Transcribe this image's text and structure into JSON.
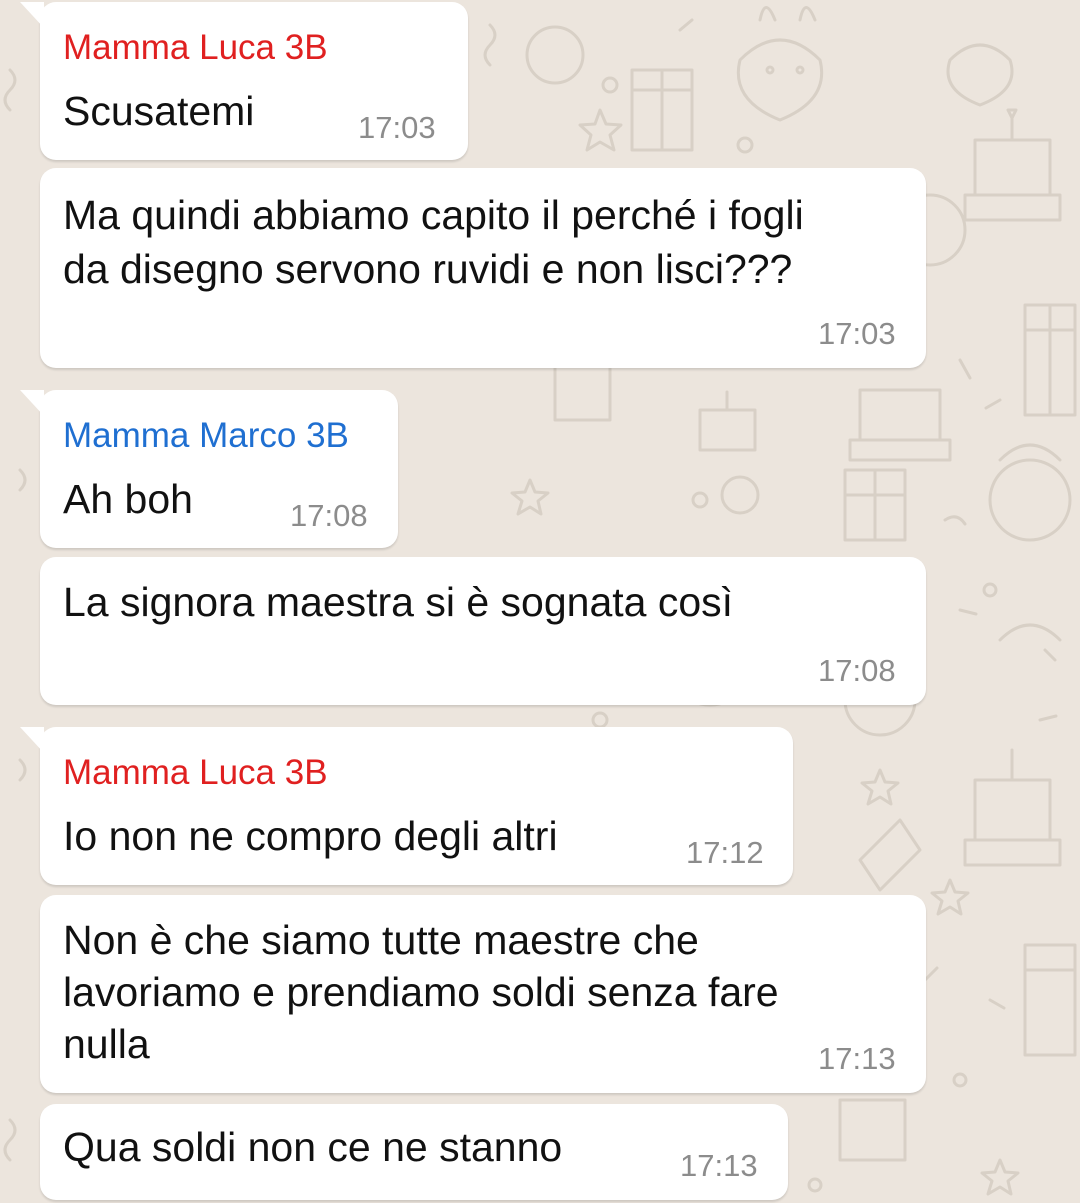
{
  "chat": {
    "messages": [
      {
        "sender": "Mamma Luca 3B",
        "sender_color": "#e02020",
        "text": "Scusatemi",
        "time": "17:03"
      },
      {
        "sender": "",
        "text_lines": [
          "Ma quindi abbiamo capito il perché i fogli",
          "da disegno servono ruvidi e non lisci???"
        ],
        "time": "17:03"
      },
      {
        "sender": "Mamma Marco 3B",
        "sender_color": "#1f6fd1",
        "text": "Ah boh",
        "time": "17:08"
      },
      {
        "sender": "",
        "text": "La signora maestra si è sognata così",
        "time": "17:08"
      },
      {
        "sender": "Mamma Luca 3B",
        "sender_color": "#e02020",
        "text": "Io non ne compro degli altri",
        "time": "17:12"
      },
      {
        "sender": "",
        "text_lines": [
          "Non è che siamo tutte maestre che",
          "lavoriamo e prendiamo soldi senza fare",
          "nulla"
        ],
        "time": "17:13"
      },
      {
        "sender": "",
        "text": "Qua soldi non ce ne stanno",
        "time": "17:13"
      }
    ]
  },
  "colors": {
    "background": "#ece5dd",
    "bubble": "#ffffff",
    "timestamp": "#8c8c8c"
  }
}
